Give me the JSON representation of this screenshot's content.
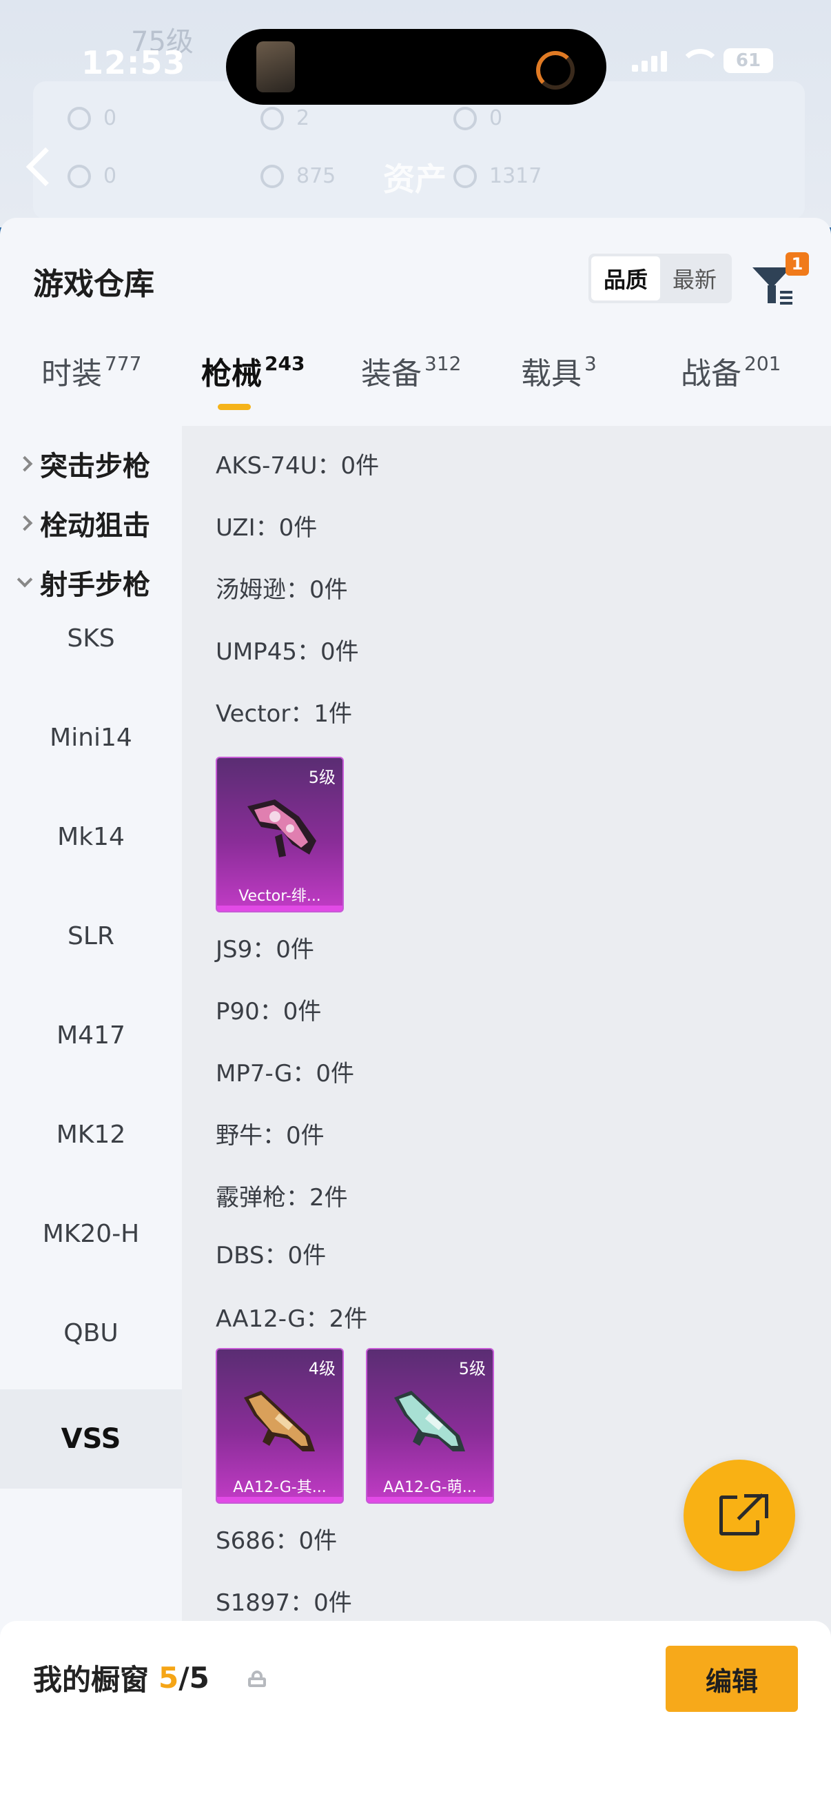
{
  "status_bar": {
    "time": "12:53",
    "battery": "61"
  },
  "header": {
    "title": "资产"
  },
  "sheet": {
    "title": "游戏仓库",
    "sort_options": [
      "品质",
      "最新"
    ],
    "filter_badge": "1"
  },
  "tabs": [
    {
      "label": "时装",
      "count": "777"
    },
    {
      "label": "枪械",
      "count": "243"
    },
    {
      "label": "装备",
      "count": "312"
    },
    {
      "label": "载具",
      "count": "3"
    },
    {
      "label": "战备",
      "count": "201"
    }
  ],
  "sidebar": {
    "categories": [
      "突击步枪",
      "栓动狙击",
      "射手步枪"
    ],
    "subitems": [
      "SKS",
      "Mini14",
      "Mk14",
      "SLR",
      "M417",
      "MK12",
      "MK20-H",
      "QBU",
      "VSS"
    ]
  },
  "weapons": {
    "rows": [
      "AKS-74U：0件",
      "UZI：0件",
      "汤姆逊：0件",
      "UMP45：0件",
      "Vector：1件",
      "JS9：0件",
      "P90：0件",
      "MP7-G：0件",
      "野牛：0件",
      "霰弹枪：2件",
      "DBS：0件",
      "AA12-G：2件",
      "S686：0件",
      "S1897：0件"
    ],
    "vector_items": [
      {
        "level": "5级",
        "name": "Vector-绯..."
      }
    ],
    "aa12_items": [
      {
        "level": "4级",
        "name": "AA12-G-其..."
      },
      {
        "level": "5级",
        "name": "AA12-G-萌..."
      }
    ]
  },
  "showcase": {
    "label": "我的橱窗",
    "current": "5",
    "total": "/5",
    "edit_label": "编辑"
  }
}
